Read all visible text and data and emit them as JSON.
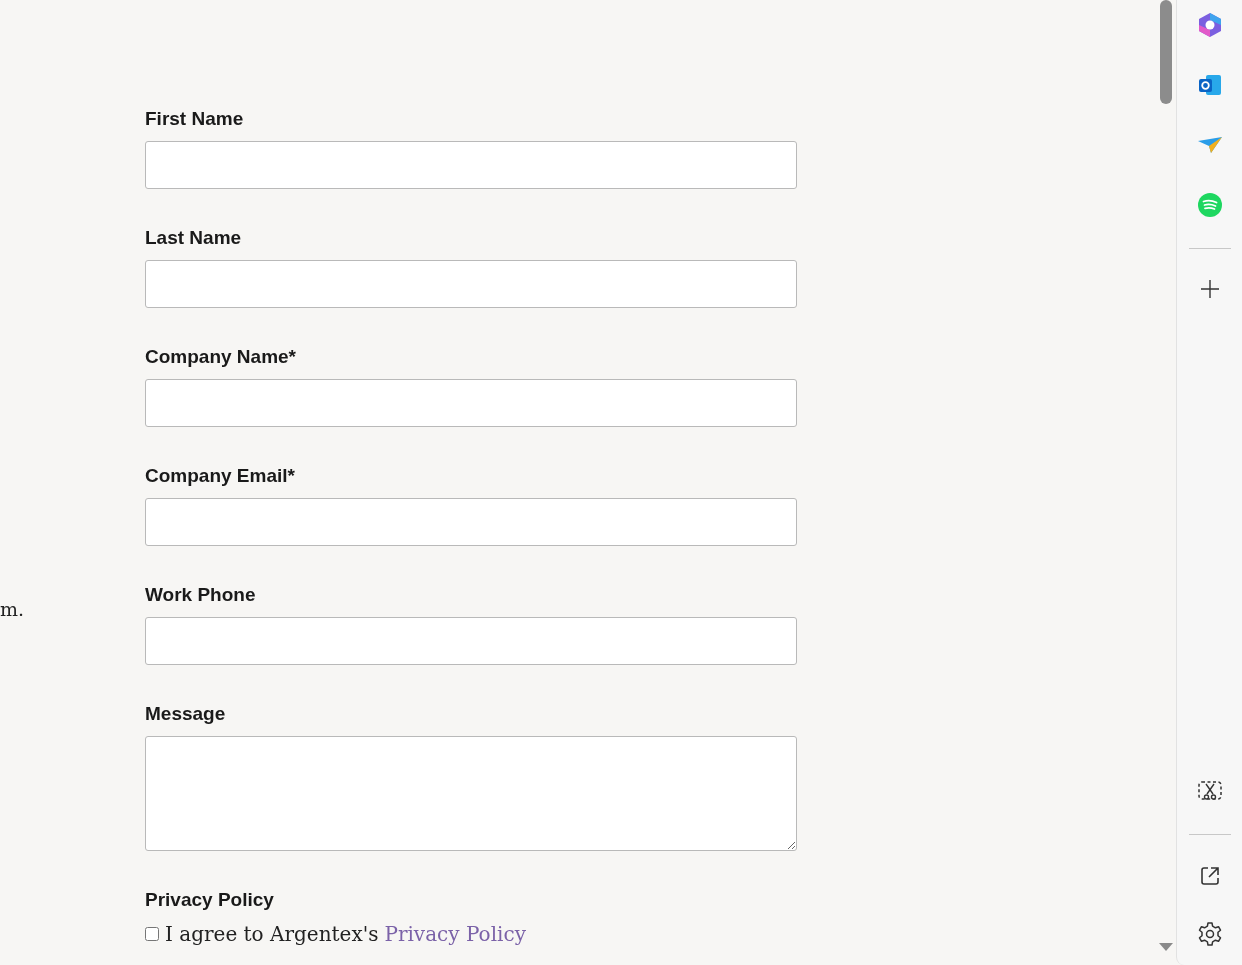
{
  "side_text": "m.",
  "form": {
    "fields": [
      {
        "label": "First Name",
        "kind": "input"
      },
      {
        "label": "Last Name",
        "kind": "input"
      },
      {
        "label": "Company Name*",
        "kind": "input"
      },
      {
        "label": "Company Email*",
        "kind": "input"
      },
      {
        "label": "Work Phone",
        "kind": "input"
      },
      {
        "label": "Message",
        "kind": "textarea"
      }
    ],
    "privacy": {
      "heading": "Privacy Policy",
      "agree_text": "I agree to Argentex's",
      "link": "Privacy Policy",
      "checked": false
    }
  }
}
